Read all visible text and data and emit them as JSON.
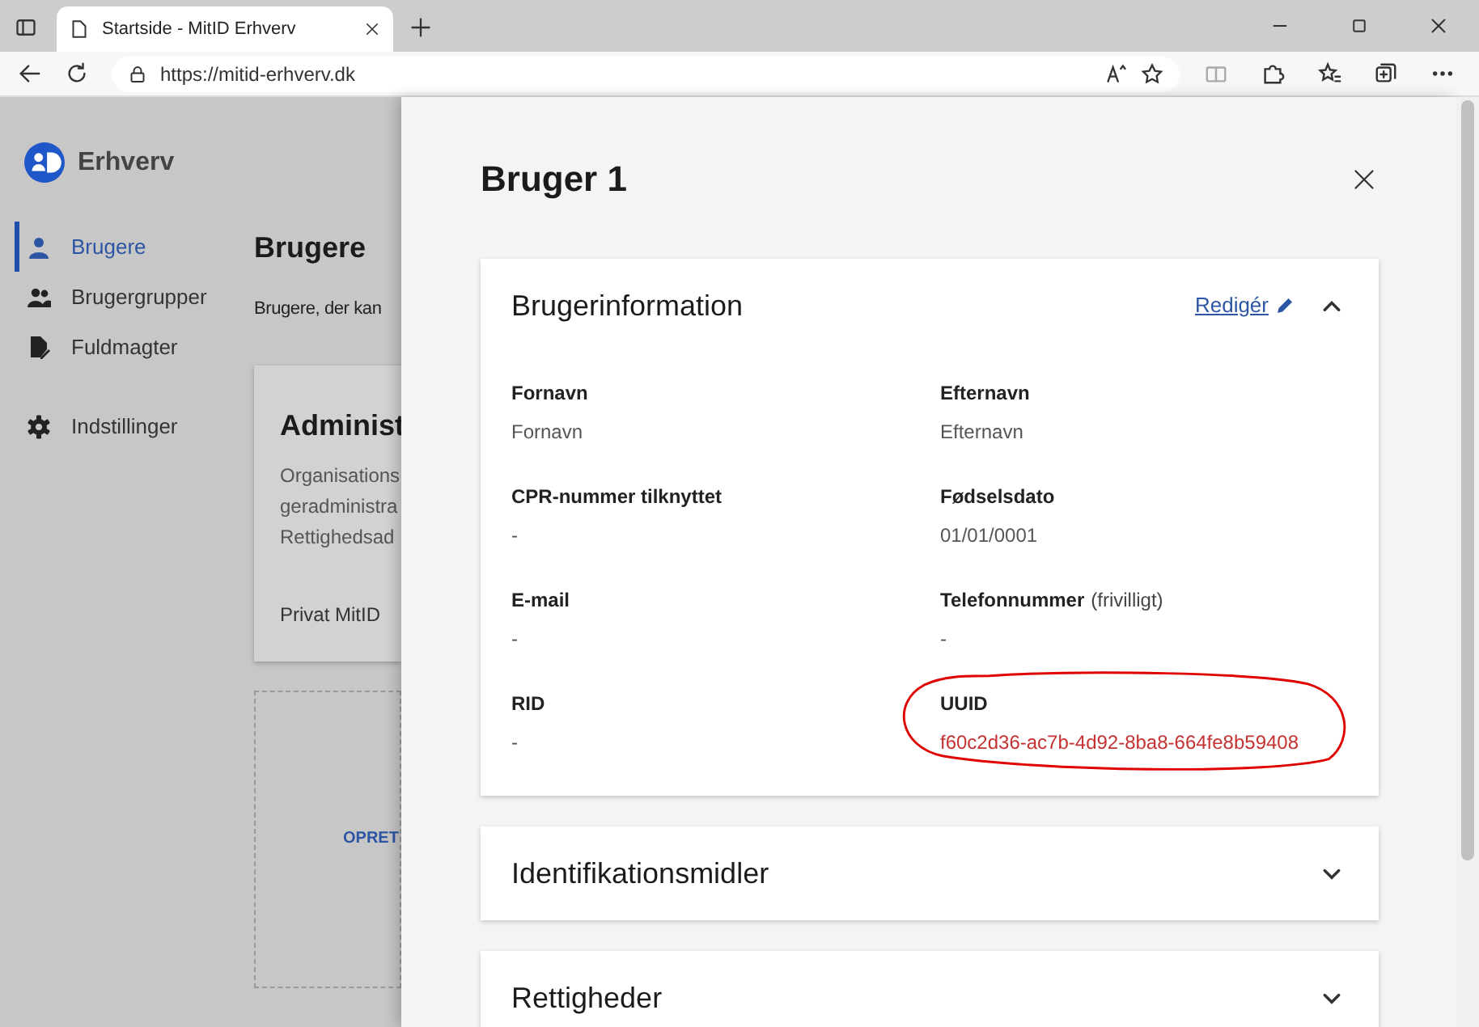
{
  "browser": {
    "tab_title": "Startside - MitID Erhverv",
    "url": "https://mitid-erhverv.dk"
  },
  "sidebar": {
    "logo_text": "Erhverv",
    "items": [
      {
        "label": "Brugere",
        "selected": true
      },
      {
        "label": "Brugergrupper",
        "selected": false
      },
      {
        "label": "Fuldmagter",
        "selected": false
      },
      {
        "label": "Indstillinger",
        "selected": false
      }
    ]
  },
  "background_page": {
    "title": "Brugere",
    "description": "Brugere, der kan",
    "card": {
      "title": "Administ",
      "lines": [
        "Organisations",
        "geradministra",
        "Rettighedsad"
      ],
      "footer": "Privat MitID"
    },
    "create_button": "OPRET"
  },
  "drawer": {
    "title": "Bruger 1",
    "sections": [
      {
        "title": "Brugerinformation",
        "expanded": true,
        "edit_link": "Redigér",
        "fields": [
          {
            "label": "Fornavn",
            "value": "Fornavn",
            "highlighted": false
          },
          {
            "label": "Efternavn",
            "value": "Efternavn",
            "highlighted": false
          },
          {
            "label": "CPR-nummer tilknyttet",
            "value": "-",
            "highlighted": false
          },
          {
            "label": "Fødselsdato",
            "value": "01/01/0001",
            "highlighted": false
          },
          {
            "label": "E-mail",
            "value": "-",
            "highlighted": false
          },
          {
            "label": "Telefonnummer",
            "note": "(frivilligt)",
            "value": "-",
            "highlighted": false
          },
          {
            "label": "RID",
            "value": "-",
            "highlighted": false
          },
          {
            "label": "UUID",
            "value": "f60c2d36-ac7b-4d92-8ba8-664fe8b59408",
            "highlighted": true
          }
        ]
      },
      {
        "title": "Identifikationsmidler",
        "expanded": false
      },
      {
        "title": "Rettigheder",
        "expanded": false
      }
    ]
  }
}
